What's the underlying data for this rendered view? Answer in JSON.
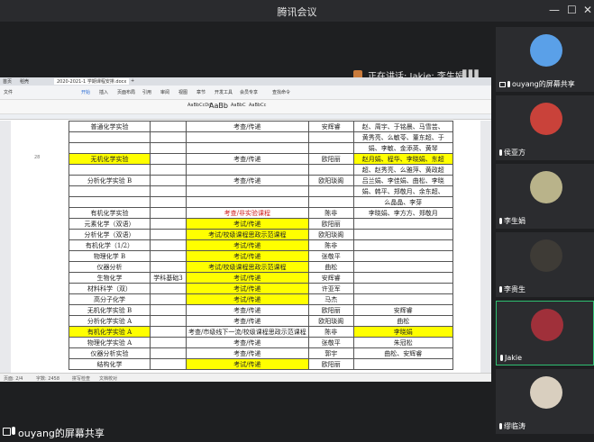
{
  "window": {
    "title": "腾讯会议",
    "minimize": "—",
    "maximize": "☐",
    "close": "✕"
  },
  "speaking": {
    "label": "正在讲话: Jakie; 李生娟;"
  },
  "grid_toggle": "▮▮▮",
  "sharer_label": "ouyang的屏幕共享",
  "doc": {
    "tabs": [
      "首页",
      "稻壳",
      "2020-2021-1 学期课程安排.docx",
      "+"
    ],
    "ribbon": [
      "文件",
      "开始",
      "插入",
      "页面布局",
      "引用",
      "审阅",
      "视图",
      "章节",
      "开发工具",
      "会员专享",
      "查找命令"
    ],
    "style_samples": [
      "AaBbCcDd",
      "AaBb",
      "AaBbC",
      "AaBbCc"
    ],
    "status": [
      "页面: 2/4",
      "字数: 2458",
      "拼写检查",
      "文档校对"
    ],
    "rows": [
      {
        "course": "普通化学实验",
        "method": "考查/传递",
        "teacher": "安辉睿",
        "extra": "赵、周宇、于铭晨、马雪芸、",
        "hl": false
      },
      {
        "course": "",
        "method": "",
        "teacher": "",
        "extra": "黄秀亮、么敏苓、董东超、于",
        "hl": false
      },
      {
        "course": "",
        "method": "",
        "teacher": "",
        "extra": "娟、李敏、金添英、黄琴",
        "hl": false
      },
      {
        "course": "无机化学实验",
        "method": "考查/传递",
        "teacher": "欧阳丽",
        "extra": "赵月娟、程华、李晓娟、东超",
        "hl": true
      },
      {
        "course": "",
        "method": "",
        "teacher": "",
        "extra": "超、赵秀亮、么雅萍、黄政超",
        "hl": false
      },
      {
        "course": "分析化学实验 B",
        "method": "考查/传递",
        "teacher": "欧阳琰阁",
        "extra": "吕兰娟、李佳娟、曲松、李晓",
        "hl": false
      },
      {
        "course": "",
        "method": "",
        "teacher": "",
        "extra": "娟、韩平、郑敬月、余东超、",
        "hl": false
      },
      {
        "course": "",
        "method": "",
        "teacher": "",
        "extra": "么晶晶、李芽",
        "hl": false
      },
      {
        "course": "有机化学实验",
        "method": "考查/非实验课程",
        "teacher": "陈非",
        "extra": "李晓娟、李方方、郑敬月",
        "hl": false
      },
      {
        "course": "元素化学（双语）",
        "method": "考试/传递",
        "teacher": "欧阳丽",
        "extra": "",
        "hl": false
      },
      {
        "course": "分析化学（双语）",
        "method": "考试/校级课程思政示范课程",
        "teacher": "欧阳琰阁",
        "extra": "",
        "hl": false
      },
      {
        "course": "有机化学（1/2）",
        "method": "考试/传递",
        "teacher": "陈非",
        "extra": "",
        "hl": false
      },
      {
        "course": "物理化学 B",
        "method": "考试/传递",
        "teacher": "张敬平",
        "extra": "",
        "hl": false
      },
      {
        "course": "仪器分析",
        "method": "考试/校级课程思政示范课程",
        "teacher": "曲松",
        "extra": "",
        "hl": false
      },
      {
        "course": "生物化学",
        "method": "考试/传递",
        "teacher": "安辉睿",
        "extra": "",
        "hl": false
      },
      {
        "course": "材料科学（双）",
        "method": "考试/传递",
        "teacher": "许亚军",
        "extra": "",
        "hl": false
      },
      {
        "course": "高分子化学",
        "method": "考试/传递",
        "teacher": "马杰",
        "extra": "",
        "hl": false
      },
      {
        "course": "无机化学实验 B",
        "method": "考查/传递",
        "teacher": "欧阳丽",
        "extra": "安辉睿",
        "hl": false
      },
      {
        "course": "分析化学实验 A",
        "method": "考查/传递",
        "teacher": "欧阳琰阁",
        "extra": "曲松",
        "hl": false
      },
      {
        "course": "有机化学实验 A",
        "method": "考查/市级线下一流/校级课程思政示范课程",
        "teacher": "陈非",
        "extra": "李晓娟",
        "hl": true
      },
      {
        "course": "物理化学实验 A",
        "method": "考查/传递",
        "teacher": "张敬平",
        "extra": "朱冠松",
        "hl": false
      },
      {
        "course": "仪器分析实验",
        "method": "考查/传递",
        "teacher": "郭宇",
        "extra": "曲松、安辉睿",
        "hl": false
      },
      {
        "course": "结构化学",
        "method": "考试/传递",
        "teacher": "欧阳丽",
        "extra": "",
        "hl": false
      }
    ],
    "group_label": "学科基础3",
    "left_marker": "28"
  },
  "participants": [
    {
      "name": "ouyang的屏幕共享",
      "color": "#5aa0e8",
      "active": false
    },
    {
      "name": "侯亚方",
      "color": "#c9423a",
      "active": false
    },
    {
      "name": "李生娟",
      "color": "#b9b38a",
      "active": false
    },
    {
      "name": "李贵生",
      "color": "#3e3b36",
      "active": false
    },
    {
      "name": "Jakie",
      "color": "#a0303a",
      "active": true
    },
    {
      "name": "缪临涛",
      "color": "#d9cfbf",
      "active": false
    }
  ]
}
